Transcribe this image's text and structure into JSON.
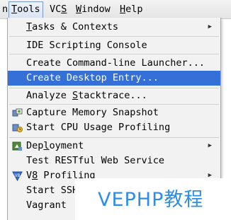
{
  "menubar": {
    "items": [
      {
        "label": "n"
      },
      {
        "label": "Tools",
        "mnemonic": "T",
        "rest": "ools"
      },
      {
        "label": "VCS",
        "pre": "VC",
        "mnemonic": "S"
      },
      {
        "label": "Window",
        "mnemonic": "W",
        "rest": "indow"
      },
      {
        "label": "Help",
        "mnemonic": "H",
        "rest": "elp"
      }
    ]
  },
  "tools_menu": {
    "items": [
      {
        "label": "Tasks & Contexts",
        "pre": "",
        "mnemonic": "T",
        "rest": "asks & Contexts",
        "submenu": true
      },
      {
        "label": "IDE Scripting Console"
      },
      {
        "label": "Create Command-line Launcher..."
      },
      {
        "label": "Create Desktop Entry..."
      },
      {
        "label": "Analyze Stacktrace...",
        "pre": "Analyze ",
        "mnemonic": "S",
        "rest": "tacktrace..."
      },
      {
        "label": "Capture Memory Snapshot",
        "icon": "memory-snapshot-icon"
      },
      {
        "label": "Start CPU Usage Profiling",
        "icon": "cpu-profiling-icon"
      },
      {
        "label": "Deployment",
        "pre": "Dep",
        "mnemonic": "l",
        "rest": "oyment",
        "submenu": true,
        "icon": "deployment-icon"
      },
      {
        "label": "Test RESTful Web Service"
      },
      {
        "label": "V8 Profiling",
        "pre": "V",
        "mnemonic": "8",
        "rest": " Profiling",
        "submenu": true,
        "icon": "v8-icon"
      },
      {
        "label": "Start SSH",
        "submenu": true
      },
      {
        "label": "Vagrant",
        "submenu": true
      }
    ],
    "selected": "Create Desktop Entry..."
  },
  "watermark": {
    "text": "VEPHP教程"
  },
  "colors": {
    "selection": "#3470d8",
    "menu_bg": "#f2f2f2",
    "watermark": "#2e8ee6"
  }
}
